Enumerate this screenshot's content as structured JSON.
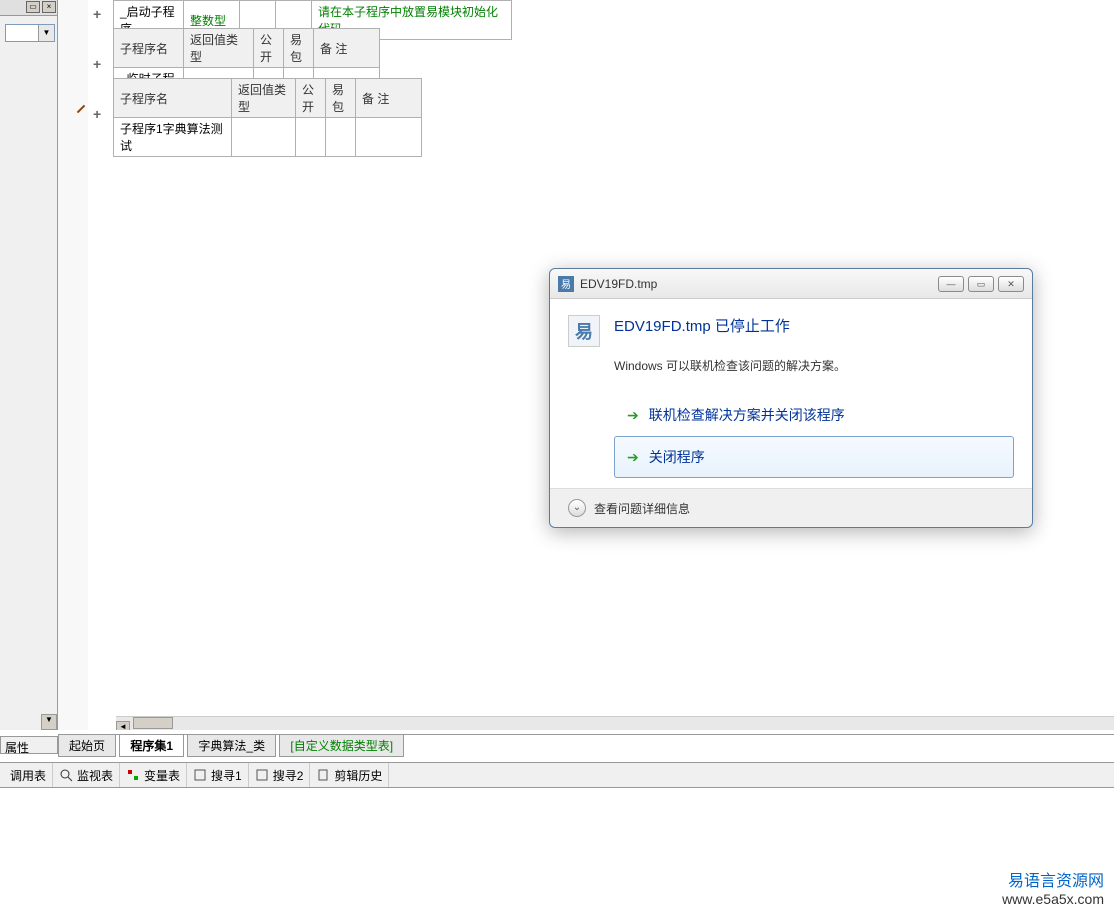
{
  "left_panel": {
    "props_label": "属性"
  },
  "tables": {
    "t1": {
      "row": {
        "name": "_启动子程序",
        "type": "整数型",
        "col3": "",
        "col4": "",
        "comment": "请在本子程序中放置易模块初始化代码"
      }
    },
    "t2": {
      "headers": [
        "子程序名",
        "返回值类型",
        "公开",
        "易包",
        "备 注"
      ],
      "row": {
        "name": "_临时子程序",
        "type": "",
        "col3": "",
        "col4": "",
        "comment": ""
      }
    },
    "t3": {
      "headers": [
        "子程序名",
        "返回值类型",
        "公开",
        "易包",
        "备 注"
      ],
      "row": {
        "name": "子程序1字典算法测试",
        "type": "",
        "col3": "",
        "col4": "",
        "comment": ""
      }
    }
  },
  "tabs": {
    "t1": "起始页",
    "t2": "程序集1",
    "t3": "字典算法_类",
    "t4": "[自定义数据类型表]"
  },
  "toolbar": {
    "i1": "调用表",
    "i2": "监视表",
    "i3": "变量表",
    "i4": "搜寻1",
    "i5": "搜寻2",
    "i6": "剪辑历史"
  },
  "dialog": {
    "title": "EDV19FD.tmp",
    "main": "EDV19FD.tmp 已停止工作",
    "sub": "Windows 可以联机检查该问题的解决方案。",
    "opt1": "联机检查解决方案并关闭该程序",
    "opt2": "关闭程序",
    "details": "查看问题详细信息",
    "app_icon_char": "易"
  },
  "watermark": {
    "cn": "易语言资源网",
    "en": "www.e5a5x.com"
  }
}
